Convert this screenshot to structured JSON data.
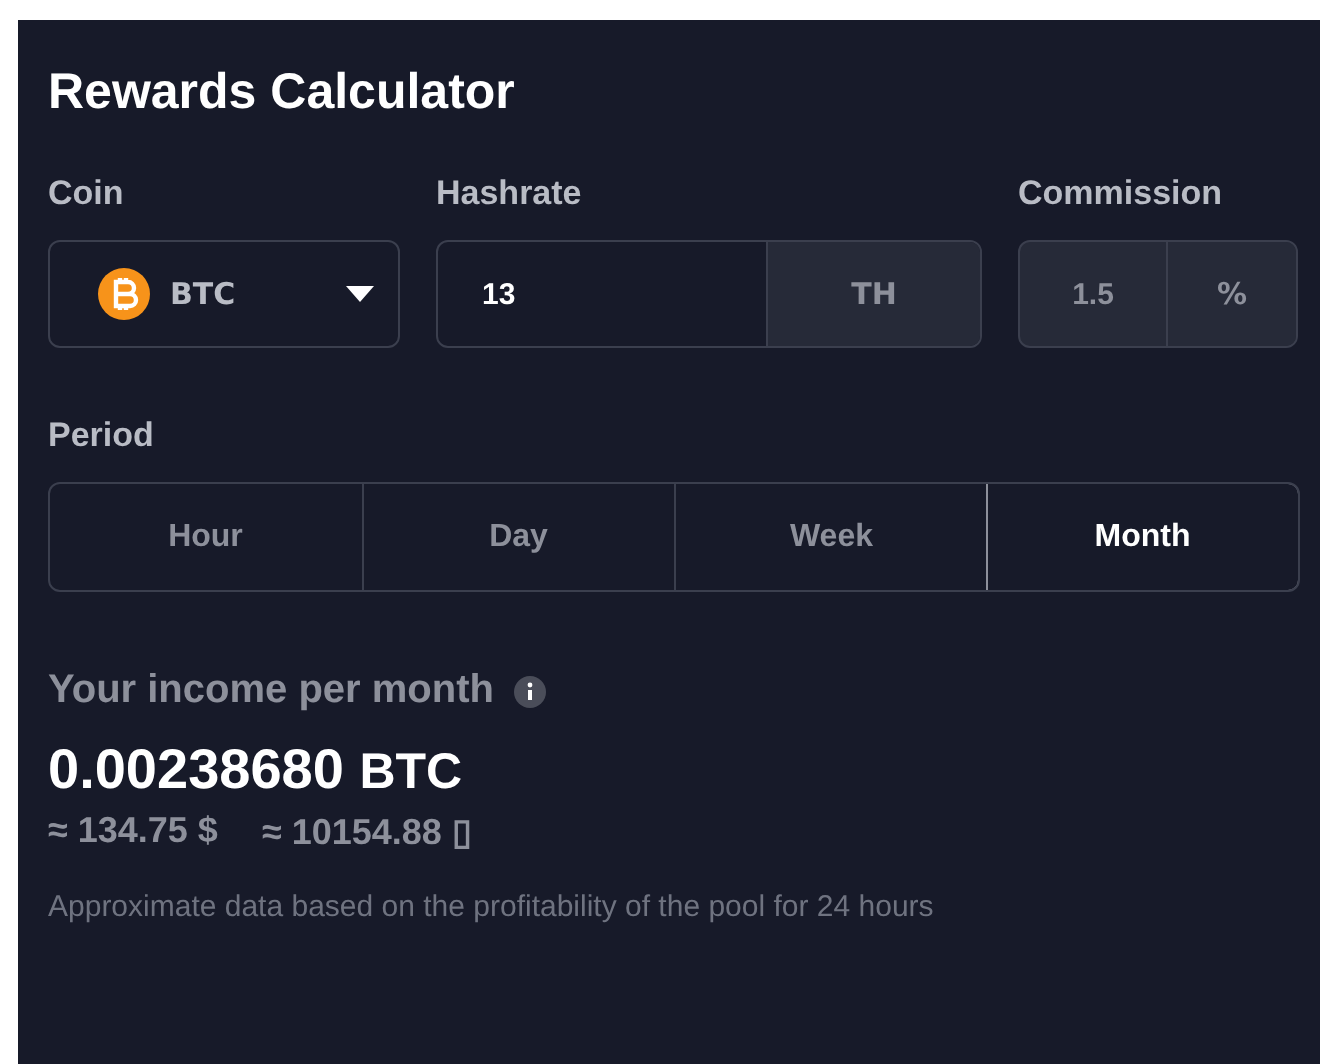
{
  "title": "Rewards Calculator",
  "coin": {
    "label": "Coin",
    "value": "BTC"
  },
  "hashrate": {
    "label": "Hashrate",
    "value": "13",
    "unit": "TH"
  },
  "commission": {
    "label": "Commission",
    "value": "1.5",
    "unit": "%"
  },
  "period": {
    "label": "Period",
    "options": [
      {
        "label": "Hour",
        "selected": false
      },
      {
        "label": "Day",
        "selected": false
      },
      {
        "label": "Week",
        "selected": false
      },
      {
        "label": "Month",
        "selected": true
      }
    ]
  },
  "income": {
    "label": "Your income per month",
    "amount": "0.00238680",
    "currency": "BTC",
    "approx": [
      "≈ 134.75 $",
      "≈ 10154.88 ▯"
    ],
    "note": "Approximate data based on the profitability of the pool for 24 hours"
  }
}
